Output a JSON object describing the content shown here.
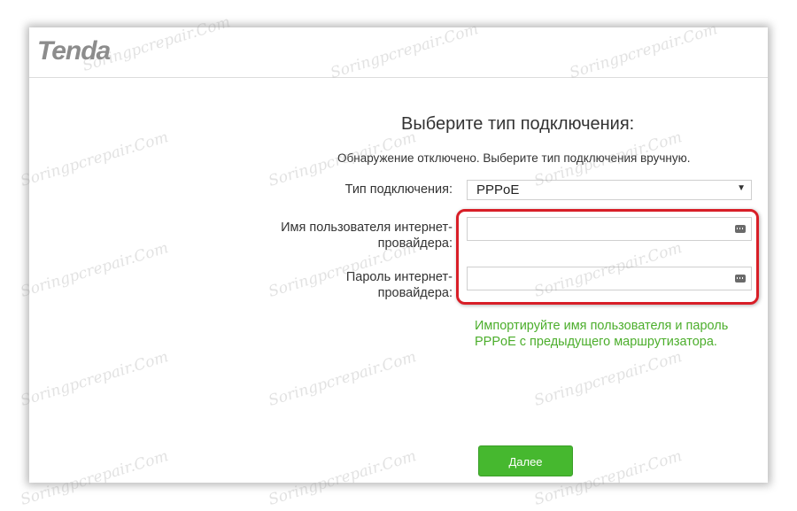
{
  "brand": {
    "logo_text": "Tenda",
    "logo_color": "#8c8c8c"
  },
  "form": {
    "title": "Выберите тип подключения:",
    "subtitle": "Обнаружение отключено. Выберите тип подключения вручную.",
    "connection_type": {
      "label": "Тип подключения:",
      "selected": "PPPoE"
    },
    "username": {
      "label": "Имя пользователя интернет-провайдера:",
      "value": ""
    },
    "password": {
      "label": "Пароль интернет-провайдера:",
      "value": ""
    },
    "import_link": "Импортируйте имя пользователя и пароль PPPoE с предыдущего маршрутизатора.",
    "next_button": "Далее"
  },
  "watermark": "Soringpcrepair.Com",
  "colors": {
    "accent_green": "#46b82f",
    "link_green": "#4cae2c",
    "highlight_red": "#d81e27"
  }
}
